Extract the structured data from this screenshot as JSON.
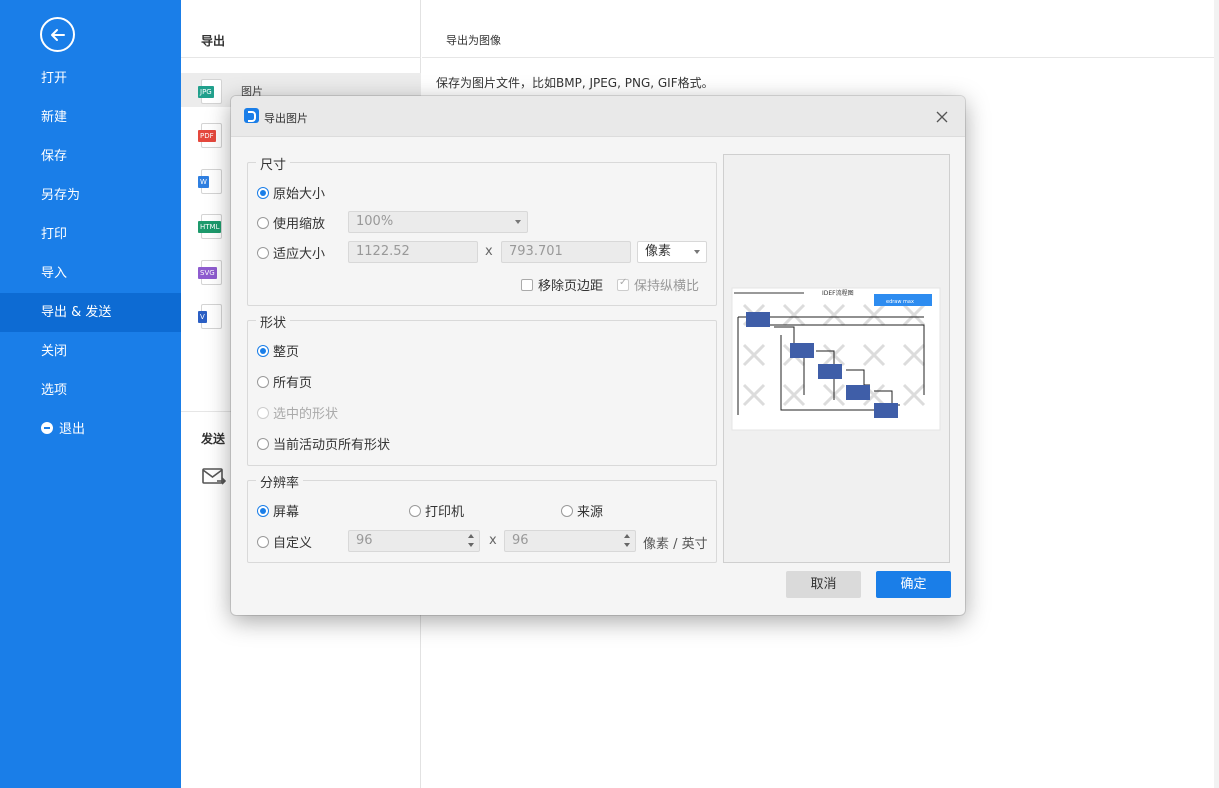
{
  "sidebar": {
    "items": [
      {
        "label": "打开"
      },
      {
        "label": "新建"
      },
      {
        "label": "保存"
      },
      {
        "label": "另存为"
      },
      {
        "label": "打印"
      },
      {
        "label": "导入"
      },
      {
        "label": "导出 & 发送"
      },
      {
        "label": "关闭"
      },
      {
        "label": "选项"
      },
      {
        "label": "退出"
      }
    ],
    "active_index": 6,
    "accent_color": "#1a7ee8"
  },
  "export_panel": {
    "title": "导出",
    "formats": [
      {
        "tag": "JPG",
        "label": "图片",
        "color": "#21a08c",
        "icon": "jpg-file-icon"
      },
      {
        "tag": "PDF",
        "color": "#e5483d",
        "icon": "pdf-file-icon"
      },
      {
        "tag": "W",
        "color": "#2f7fe0",
        "icon": "word-file-icon"
      },
      {
        "tag": "HTML",
        "color": "#1d9a6c",
        "icon": "html-file-icon"
      },
      {
        "tag": "SVG",
        "color": "#8e5ccf",
        "icon": "svg-file-icon"
      },
      {
        "tag": "V",
        "color": "#2b5fc4",
        "icon": "visio-file-icon"
      }
    ],
    "send_title": "发送"
  },
  "content": {
    "title": "导出为图像",
    "description": "保存为图片文件，比如BMP, JPEG, PNG, GIF格式。"
  },
  "dialog": {
    "title": "导出图片",
    "size": {
      "legend": "尺寸",
      "original": "原始大小",
      "use_scale": "使用缩放",
      "scale_value": "100%",
      "fit_size": "适应大小",
      "width": "1122.52",
      "x": "x",
      "height": "793.701",
      "unit": "像素",
      "remove_margin": "移除页边距",
      "keep_ratio": "保持纵横比",
      "selected": "original"
    },
    "shape": {
      "legend": "形状",
      "whole_page": "整页",
      "all_pages": "所有页",
      "selected_shapes": "选中的形状",
      "current_page_shapes": "当前活动页所有形状",
      "selected": "whole_page"
    },
    "resolution": {
      "legend": "分辨率",
      "screen": "屏幕",
      "printer": "打印机",
      "source": "来源",
      "custom": "自定义",
      "dpi_x": "96",
      "x": "x",
      "dpi_y": "96",
      "unit": "像素 / 英寸",
      "selected": "screen"
    },
    "preview": {
      "diagram_title": "IDEF流程图",
      "brand": "edraw max"
    },
    "cancel": "取消",
    "ok": "确定"
  }
}
